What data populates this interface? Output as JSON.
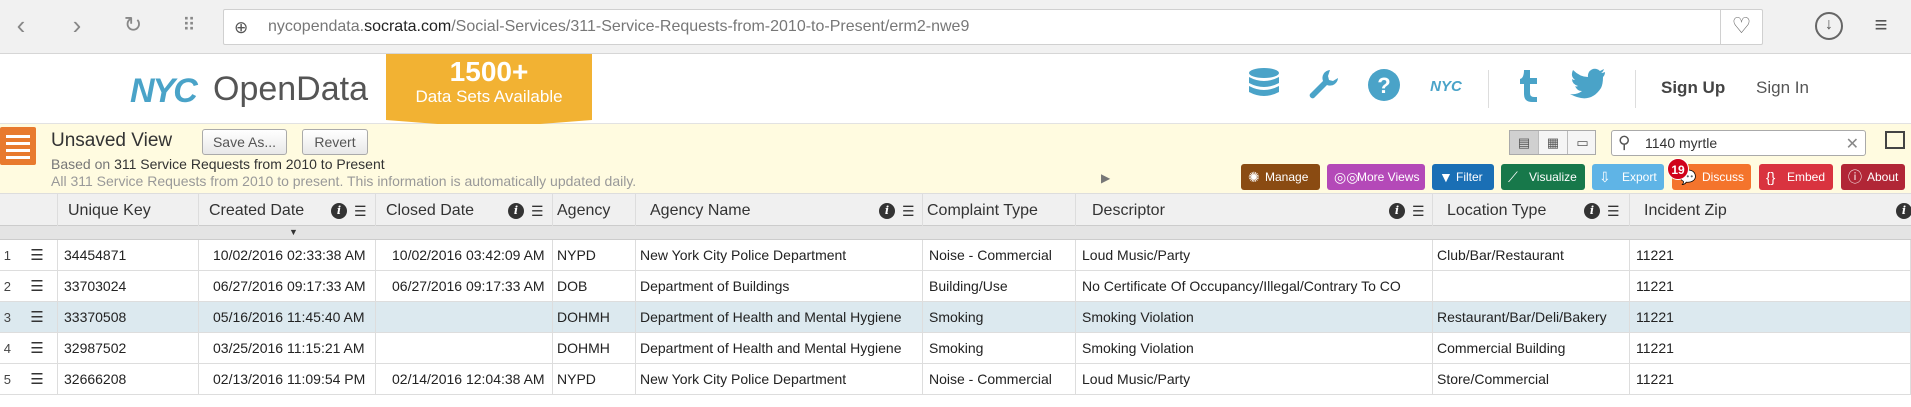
{
  "browser": {
    "url_prefix": "nycopendata.",
    "url_domain": "socrata.com",
    "url_path": "/Social-Services/311-Service-Requests-from-2010-to-Present/erm2-nwe9"
  },
  "header": {
    "logo_nyc": "NYC",
    "logo_opendata": "OpenData",
    "banner_big": "1500+",
    "banner_small": "Data Sets Available",
    "nav_nyc": "NYC",
    "sign_up": "Sign Up",
    "sign_in": "Sign In"
  },
  "dataset": {
    "view_title": "Unsaved View",
    "save_as": "Save As...",
    "revert": "Revert",
    "based_on_prefix": "Based on ",
    "based_on_link": "311 Service Requests from 2010 to Present",
    "description": "All 311 Service Requests from 2010 to present. This information is automatically updated daily.",
    "search_query": "1140 myrtle"
  },
  "toolbar": {
    "manage": "Manage",
    "more_views": "More Views",
    "filter": "Filter",
    "visualize": "Visualize",
    "export": "Export",
    "discuss": "Discuss",
    "discuss_count": "19",
    "embed": "Embed",
    "about": "About"
  },
  "colors": {
    "manage": "#8a4b12",
    "more_views": "#b449b8",
    "filter": "#1a6fb5",
    "visualize": "#17784a",
    "export": "#5fb4e6",
    "discuss": "#f4742c",
    "embed": "#d9333f",
    "about": "#b12636"
  },
  "grid": {
    "columns": [
      "Unique Key",
      "Created Date",
      "Closed Date",
      "Agency",
      "Agency Name",
      "Complaint Type",
      "Descriptor",
      "Location Type",
      "Incident Zip"
    ],
    "rows": [
      {
        "n": "1",
        "key": "34454871",
        "created": "10/02/2016 02:33:38 AM",
        "closed": "10/02/2016 03:42:09 AM",
        "agency": "NYPD",
        "agency_name": "New York City Police Department",
        "complaint": "Noise - Commercial",
        "descriptor": "Loud Music/Party",
        "location": "Club/Bar/Restaurant",
        "zip": "11221"
      },
      {
        "n": "2",
        "key": "33703024",
        "created": "06/27/2016 09:17:33 AM",
        "closed": "06/27/2016 09:17:33 AM",
        "agency": "DOB",
        "agency_name": "Department of Buildings",
        "complaint": "Building/Use",
        "descriptor": "No Certificate Of Occupancy/Illegal/Contrary To CO",
        "location": "",
        "zip": "11221"
      },
      {
        "n": "3",
        "key": "33370508",
        "created": "05/16/2016 11:45:40 AM",
        "closed": "",
        "agency": "DOHMH",
        "agency_name": "Department of Health and Mental Hygiene",
        "complaint": "Smoking",
        "descriptor": "Smoking Violation",
        "location": "Restaurant/Bar/Deli/Bakery",
        "zip": "11221"
      },
      {
        "n": "4",
        "key": "32987502",
        "created": "03/25/2016 11:15:21 AM",
        "closed": "",
        "agency": "DOHMH",
        "agency_name": "Department of Health and Mental Hygiene",
        "complaint": "Smoking",
        "descriptor": "Smoking Violation",
        "location": "Commercial Building",
        "zip": "11221"
      },
      {
        "n": "5",
        "key": "32666208",
        "created": "02/13/2016 11:09:54 PM",
        "closed": "02/14/2016 12:04:38 AM",
        "agency": "NYPD",
        "agency_name": "New York City Police Department",
        "complaint": "Noise - Commercial",
        "descriptor": "Loud Music/Party",
        "location": "Store/Commercial",
        "zip": "11221"
      }
    ]
  }
}
